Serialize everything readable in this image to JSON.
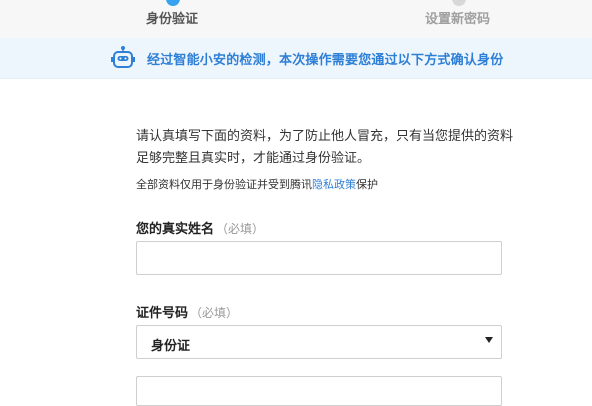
{
  "steps": {
    "current": "身份验证",
    "next": "设置新密码"
  },
  "notice": {
    "icon": "robot-icon",
    "text": "经过智能小安的检测，本次操作需要您通过以下方式确认身份"
  },
  "intro": {
    "text": "请认真填写下面的资料，为了防止他人冒充，只有当您提供的资料足够完整且真实时，才能通过身份验证。",
    "privacy_prefix": "全部资料仅用于身份验证并受到腾讯",
    "privacy_link": "隐私政策",
    "privacy_suffix": "保护"
  },
  "form": {
    "name_label": "您的真实姓名",
    "name_hint": "（必填）",
    "name_value": "",
    "id_label": "证件号码",
    "id_hint": "（必填）",
    "id_type_selected": "身份证",
    "id_number_value": ""
  },
  "colors": {
    "accent": "#2e7fd6",
    "step_active": "#36a2f0"
  }
}
